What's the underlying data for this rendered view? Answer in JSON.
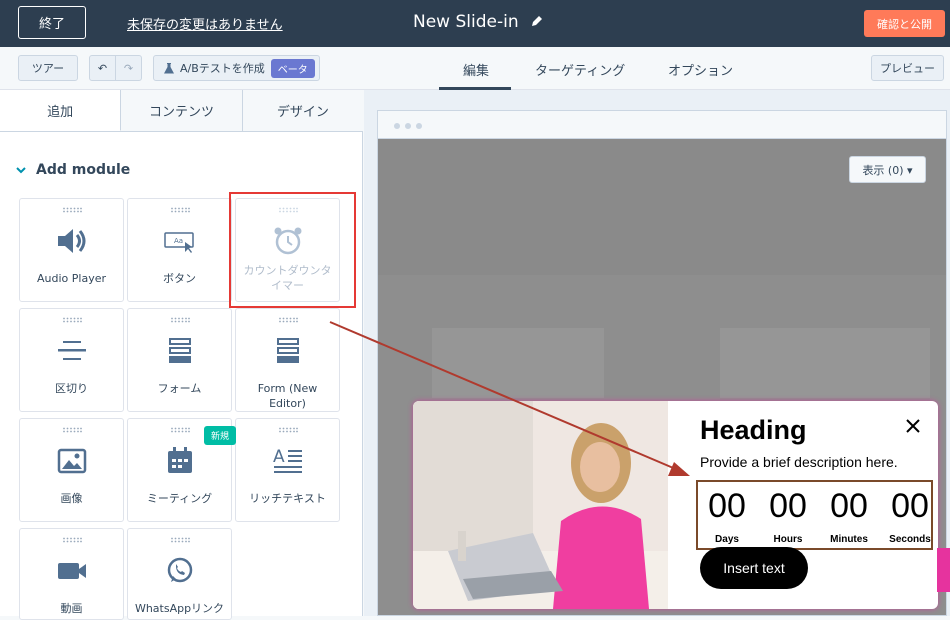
{
  "topbar": {
    "exit_label": "終了",
    "unsaved_label": "未保存の変更はありません",
    "title": "New Slide-in",
    "publish_label": "確認と公開"
  },
  "toolbar": {
    "tour_label": "ツアー",
    "undo_icon": "↶",
    "redo_icon": "↷",
    "ab_label": "A/Bテストを作成",
    "beta_label": "ベータ",
    "tabs": [
      "編集",
      "ターゲティング",
      "オプション"
    ],
    "active_tab": "編集",
    "preview_label": "プレビュー"
  },
  "panel": {
    "tabs": [
      "追加",
      "コンテンツ",
      "デザイン"
    ],
    "active_tab": "追加",
    "section_title": "Add module",
    "modules": [
      {
        "label": "Audio Player",
        "icon": "speaker-icon"
      },
      {
        "label": "ボタン",
        "icon": "button-icon"
      },
      {
        "label": "カウントダウンタイマー",
        "icon": "alarm-clock-icon",
        "disabled": true
      },
      {
        "label": "区切り",
        "icon": "divider-icon"
      },
      {
        "label": "フォーム",
        "icon": "form-icon"
      },
      {
        "label": "Form (New Editor)",
        "icon": "form-icon"
      },
      {
        "label": "画像",
        "icon": "image-icon"
      },
      {
        "label": "ミーティング",
        "icon": "calendar-icon",
        "badge": "新規"
      },
      {
        "label": "リッチテキスト",
        "icon": "rich-text-icon"
      },
      {
        "label": "動画",
        "icon": "video-icon"
      },
      {
        "label": "WhatsAppリンク",
        "icon": "whatsapp-icon"
      }
    ]
  },
  "canvas": {
    "show_label": "表示 (0) ▾"
  },
  "slidein": {
    "heading": "Heading",
    "description": "Provide a brief description here.",
    "countdown": [
      {
        "value": "00",
        "label": "Days"
      },
      {
        "value": "00",
        "label": "Hours"
      },
      {
        "value": "00",
        "label": "Minutes"
      },
      {
        "value": "00",
        "label": "Seconds"
      }
    ],
    "button_label": "Insert text"
  },
  "colors": {
    "topbar": "#2d3e50",
    "publish": "#ff7a59",
    "beta": "#6a78d1",
    "badge": "#00bda5",
    "highlight": "#e53935"
  }
}
